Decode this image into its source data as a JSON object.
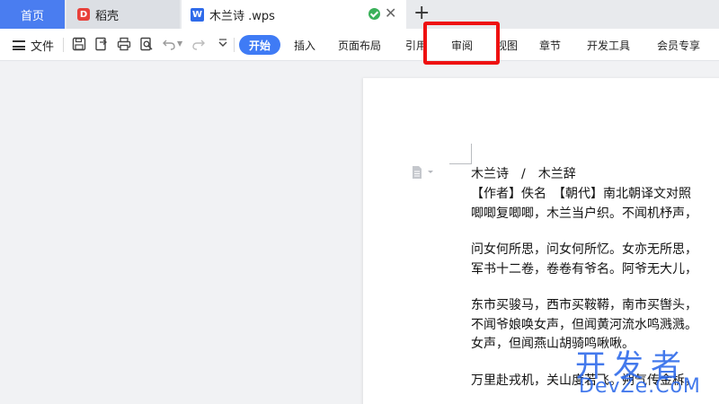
{
  "tabs": {
    "home": "首页",
    "daoke": "稻壳",
    "document": "木兰诗 .wps",
    "daoke_icon": "D",
    "doc_icon": "W"
  },
  "toolbar": {
    "file_label": "文件",
    "ribbon": [
      "开始",
      "插入",
      "页面布局",
      "引用",
      "审阅",
      "视图",
      "章节",
      "开发工具",
      "会员专享"
    ]
  },
  "document": {
    "lines": [
      "木兰诗　/　木兰辞",
      "【作者】佚名　【朝代】南北朝译文对照",
      "唧唧复唧唧，木兰当户织。不闻机杼声，",
      "问女何所思，问女何所忆。女亦无所思，",
      "军书十二卷，卷卷有爷名。阿爷无大儿，",
      "东市买骏马，西市买鞍鞯，南市买辔头，",
      "不闻爷娘唤女声，但闻黄河流水鸣溅溅。",
      "女声，但闻燕山胡骑鸣啾啾。",
      "万里赴戎机，关山度若飞。朔气传金柝，"
    ]
  },
  "watermark": {
    "cn": "开发者",
    "en": "DevZe.CoM"
  },
  "colors": {
    "accent": "#3f7bf5",
    "highlight": "#ee1111",
    "home_tab": "#4a7df0"
  }
}
